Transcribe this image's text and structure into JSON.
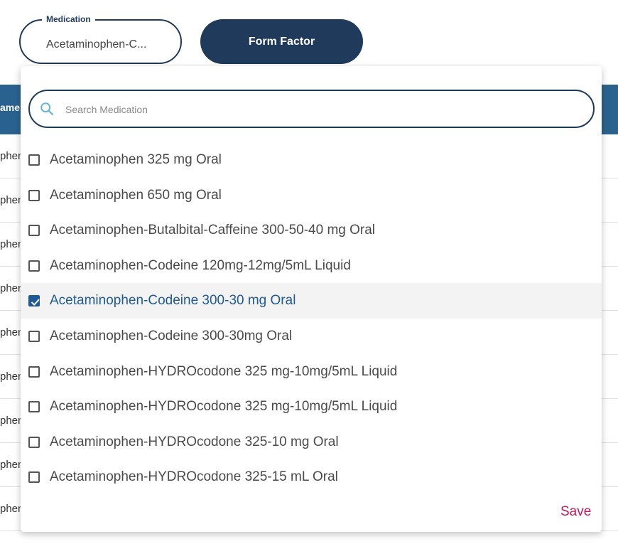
{
  "background_table": {
    "header_text": "ame",
    "row_text": "phen"
  },
  "medication_field": {
    "legend": "Medication",
    "value": "Acetaminophen-C..."
  },
  "form_factor_button": {
    "label": "Form Factor"
  },
  "dropdown": {
    "search": {
      "placeholder": "Search Medication",
      "value": ""
    },
    "options": [
      {
        "label": "Acetaminophen 325 mg Oral",
        "checked": false
      },
      {
        "label": "Acetaminophen 650 mg Oral",
        "checked": false
      },
      {
        "label": "Acetaminophen-Butalbital-Caffeine 300-50-40 mg Oral",
        "checked": false
      },
      {
        "label": "Acetaminophen-Codeine 120mg-12mg/5mL Liquid",
        "checked": false
      },
      {
        "label": "Acetaminophen-Codeine 300-30 mg Oral",
        "checked": true
      },
      {
        "label": "Acetaminophen-Codeine 300-30mg Oral",
        "checked": false
      },
      {
        "label": "Acetaminophen-HYDROcodone 325 mg-10mg/5mL Liquid",
        "checked": false
      },
      {
        "label": "Acetaminophen-HYDROcodone 325 mg-10mg/5mL Liquid",
        "checked": false
      },
      {
        "label": "Acetaminophen-HYDROcodone 325-10 mg Oral",
        "checked": false
      },
      {
        "label": "Acetaminophen-HYDROcodone 325-15 mL Oral",
        "checked": false
      }
    ],
    "save_label": "Save"
  },
  "colors": {
    "navy": "#1f3a5a",
    "header_blue": "#2a628f",
    "selected_blue": "#1f5a96",
    "save_pink": "#c2185b"
  }
}
